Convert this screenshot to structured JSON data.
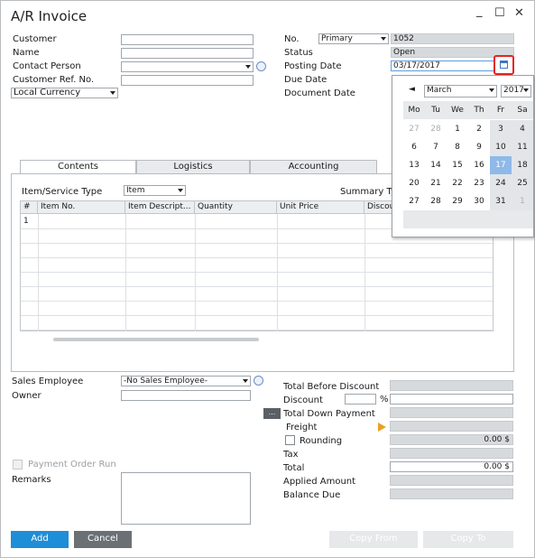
{
  "window": {
    "title": "A/R Invoice",
    "minimize": "_",
    "maximize": "☐",
    "close": "✕"
  },
  "header_left": {
    "customer_label": "Customer",
    "name_label": "Name",
    "contact_person_label": "Contact Person",
    "customer_ref_label": "Customer Ref. No.",
    "currency": "Local Currency"
  },
  "header_right": {
    "no_label": "No.",
    "series": "Primary",
    "doc_number": "1052",
    "status_label": "Status",
    "status_value": "Open",
    "posting_date_label": "Posting Date",
    "posting_date_value": "03/17/2017",
    "due_date_label": "Due Date",
    "document_date_label": "Document Date"
  },
  "calendar": {
    "month": "March",
    "year": "2017",
    "prev": "◄",
    "weekdays": [
      "Mo",
      "Tu",
      "We",
      "Th",
      "Fr",
      "Sa"
    ],
    "weeks": [
      [
        "27",
        "28",
        "1",
        "2",
        "3",
        "4"
      ],
      [
        "6",
        "7",
        "8",
        "9",
        "10",
        "11"
      ],
      [
        "13",
        "14",
        "15",
        "16",
        "17",
        "18"
      ],
      [
        "20",
        "21",
        "22",
        "23",
        "24",
        "25"
      ],
      [
        "27",
        "28",
        "29",
        "30",
        "31",
        "1"
      ]
    ],
    "selected": "17"
  },
  "tabs": [
    "Contents",
    "Logistics",
    "Accounting"
  ],
  "contents": {
    "item_service_type_label": "Item/Service Type",
    "item_service_type_value": "Item",
    "summary_type_label": "Summary Ty",
    "columns": [
      "#",
      "Item No.",
      "Item Descript...",
      "Quantity",
      "Unit Price",
      "Discou"
    ],
    "rows": [
      [
        "1",
        "",
        "",
        "",
        "",
        ""
      ]
    ]
  },
  "footer_left": {
    "sales_employee_label": "Sales Employee",
    "sales_employee_value": "-No Sales Employee-",
    "owner_label": "Owner",
    "payment_order_run_label": "Payment Order Run",
    "remarks_label": "Remarks"
  },
  "totals": {
    "total_before_discount": "Total Before Discount",
    "discount": "Discount",
    "percent": "%",
    "total_down_payment": "Total Down Payment",
    "ellipsis": "...",
    "freight": "Freight",
    "rounding": "Rounding",
    "rounding_value": "0.00 $",
    "tax": "Tax",
    "total": "Total",
    "total_value": "0.00 $",
    "applied_amount": "Applied Amount",
    "balance_due": "Balance Due"
  },
  "buttons": {
    "add": "Add",
    "cancel": "Cancel",
    "copy_from": "Copy From",
    "copy_to": "Copy To"
  },
  "colors": {
    "accent": "#1e8ed8",
    "readonly": "#d7dadd",
    "highlight": "#e8231e",
    "selected_day": "#8fb9e8"
  }
}
